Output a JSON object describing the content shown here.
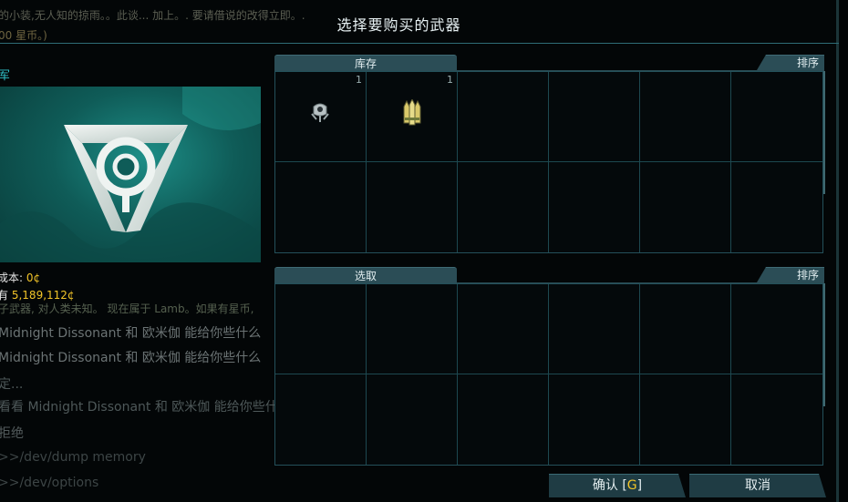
{
  "dialog": {
    "title": "选择要购买的武器"
  },
  "background": {
    "top_line_1": "的小装,无人知的掠雨。。此谈... 加上。. 要请借说的改得立即。.",
    "top_line_2": "00 星币。)"
  },
  "left": {
    "faction_label": "军",
    "cost_label": "成本:",
    "cost_value": "0¢",
    "owned_label": "有",
    "owned_value": "5,189,112¢",
    "log_lines": [
      "子武器, 对人类未知。 现在属于 Lamb。如果有星币,",
      "Midnight Dissonant 和 欧米伽 能给你些什么",
      "Midnight Dissonant 和 欧米伽 能给你些什么",
      "定...",
      "看看 Midnight Dissonant 和 欧米伽 能给你些什么",
      "拒绝",
      ">>/dev/dump memory",
      ">>/dev/options"
    ]
  },
  "inventory_panel": {
    "tab_label": "库存",
    "sort_label": "排序",
    "cells": [
      {
        "count": "1",
        "icon": "drone-weapon-icon"
      },
      {
        "count": "1",
        "icon": "triple-missile-icon"
      },
      {
        "count": "",
        "icon": ""
      },
      {
        "count": "",
        "icon": ""
      },
      {
        "count": "",
        "icon": ""
      },
      {
        "count": "",
        "icon": ""
      },
      {
        "count": "",
        "icon": ""
      },
      {
        "count": "",
        "icon": ""
      },
      {
        "count": "",
        "icon": ""
      },
      {
        "count": "",
        "icon": ""
      },
      {
        "count": "",
        "icon": ""
      },
      {
        "count": "",
        "icon": ""
      }
    ]
  },
  "selection_panel": {
    "tab_label": "选取",
    "sort_label": "排序"
  },
  "buttons": {
    "confirm_label": "确认 [",
    "confirm_hotkey": "G",
    "confirm_suffix": "]",
    "cancel_label": "取消"
  },
  "colors": {
    "accent_teal": "#2fc0c8",
    "credit_yellow": "#f2c428",
    "panel_border": "#24505a"
  }
}
